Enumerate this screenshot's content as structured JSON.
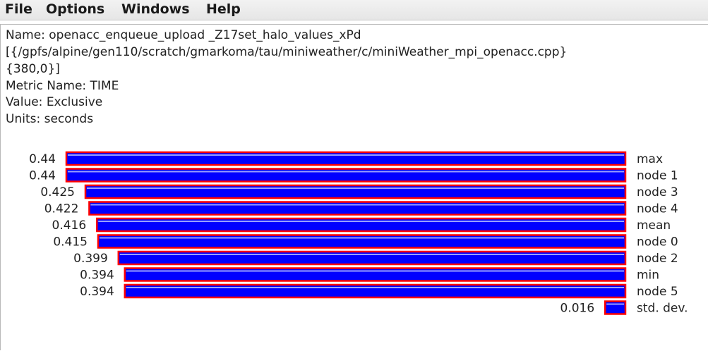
{
  "menu": {
    "items": [
      "File",
      "Options",
      "Windows",
      "Help"
    ]
  },
  "info": {
    "name_line": "Name: openacc_enqueue_upload _Z17set_halo_values_xPd",
    "path_line": "[{/gpfs/alpine/gen110/scratch/gmarkoma/tau/miniweather/c/miniWeather_mpi_openacc.cpp}",
    "loc_line": "{380,0}]",
    "metric_line": "Metric Name: TIME",
    "value_line": "Value: Exclusive",
    "units_line": "Units: seconds"
  },
  "colors": {
    "bar_fill": "#0000ff",
    "bar_border": "#ff0000",
    "bar_highlight": "#9aa0ff"
  },
  "chart_data": {
    "type": "bar",
    "orientation": "horizontal",
    "alignment": "right",
    "categories": [
      "max",
      "node 1",
      "node 3",
      "node 4",
      "mean",
      "node 0",
      "node 2",
      "min",
      "node 5",
      "std. dev."
    ],
    "value_labels": [
      "0.44",
      "0.44",
      "0.425",
      "0.422",
      "0.416",
      "0.415",
      "0.399",
      "0.394",
      "0.394",
      "0.016"
    ],
    "values": [
      0.44,
      0.44,
      0.425,
      0.422,
      0.416,
      0.415,
      0.399,
      0.394,
      0.394,
      0.016
    ],
    "xlim": [
      0,
      0.44
    ]
  }
}
